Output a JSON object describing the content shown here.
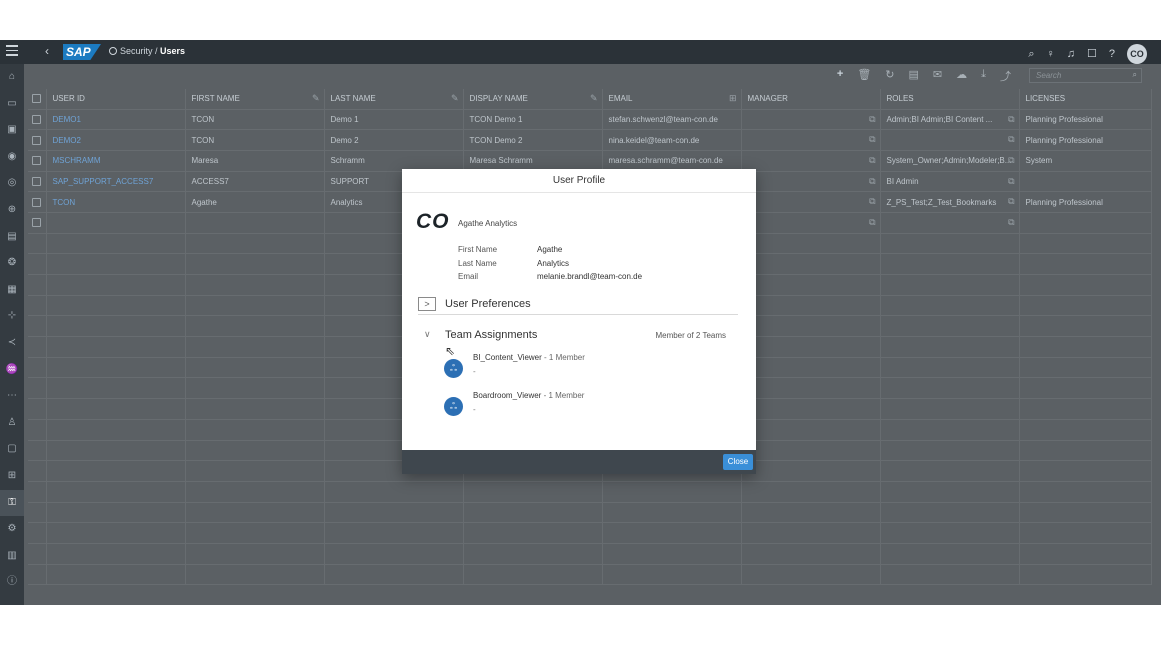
{
  "shell": {
    "back": "‹",
    "logo": "SAP",
    "breadcrumb_parent": "Security",
    "breadcrumb_sep": " / ",
    "breadcrumb_current": "Users",
    "avatar_initials": "CO",
    "icons": [
      "search-icon",
      "lightbulb-icon",
      "bell-icon",
      "chat-icon",
      "help-icon"
    ]
  },
  "sidenav": {
    "icons": [
      "home-icon",
      "files-icon",
      "stories-icon",
      "analytic-apps-icon",
      "explorer-icon",
      "modeler-icon",
      "data-icon",
      "connections-icon",
      "deployment-icon",
      "predictive-icon",
      "share-icon",
      "insights-icon",
      "more-icon",
      "users-icon",
      "roles-icon",
      "teams-icon",
      "security-icon",
      "system-icon",
      "transport-icon",
      "info-icon"
    ],
    "active_index": 16
  },
  "toolbar": {
    "icons": [
      "+",
      "🗑",
      "↻",
      "▤",
      "✉",
      "☁",
      "⤓",
      "⤴"
    ],
    "search_placeholder": "Search"
  },
  "table": {
    "columns": [
      "USER ID",
      "FIRST NAME",
      "LAST NAME",
      "DISPLAY NAME",
      "EMAIL",
      "MANAGER",
      "ROLES",
      "LICENSES"
    ],
    "rows": [
      {
        "user_id": "DEMO1",
        "first": "TCON",
        "last": "Demo 1",
        "display": "TCON Demo 1",
        "email": "stefan.schwenzl@team-con.de",
        "manager": "",
        "roles": "Admin;BI Admin;BI Content ...",
        "licenses": "Planning Professional"
      },
      {
        "user_id": "DEMO2",
        "first": "TCON",
        "last": "Demo 2",
        "display": "TCON Demo 2",
        "email": "nina.keidel@team-con.de",
        "manager": "",
        "roles": "",
        "licenses": "Planning Professional"
      },
      {
        "user_id": "MSCHRAMM",
        "first": "Maresa",
        "last": "Schramm",
        "display": "Maresa Schramm",
        "email": "maresa.schramm@team-con.de",
        "manager": "",
        "roles": "System_Owner;Admin;Modeler;B...",
        "licenses": "System"
      },
      {
        "user_id": "SAP_SUPPORT_ACCESS7",
        "first": "ACCESS7",
        "last": "SUPPORT",
        "display": "",
        "email": "",
        "manager": "",
        "roles": "BI Admin",
        "licenses": ""
      },
      {
        "user_id": "TCON",
        "first": "Agathe",
        "last": "Analytics",
        "display": "",
        "email": "",
        "manager": "",
        "roles": "Z_PS_Test;Z_Test_Bookmarks",
        "licenses": "Planning Professional"
      }
    ]
  },
  "dialog": {
    "title": "User Profile",
    "initials": "CO",
    "full_name": "Agathe Analytics",
    "fields": [
      {
        "label": "First Name",
        "value": "Agathe"
      },
      {
        "label": "Last Name",
        "value": "Analytics"
      },
      {
        "label": "Email",
        "value": "melanie.brandl@team-con.de"
      }
    ],
    "preferences_label": "User Preferences",
    "teams_label": "Team Assignments",
    "teams_count": "Member of 2 Teams",
    "teams": [
      {
        "name": "BI_Content_Viewer",
        "count": " - 1 Member",
        "desc": "-"
      },
      {
        "name": "Boardroom_Viewer",
        "count": " - 1 Member",
        "desc": "-"
      }
    ],
    "close_label": "Close"
  }
}
